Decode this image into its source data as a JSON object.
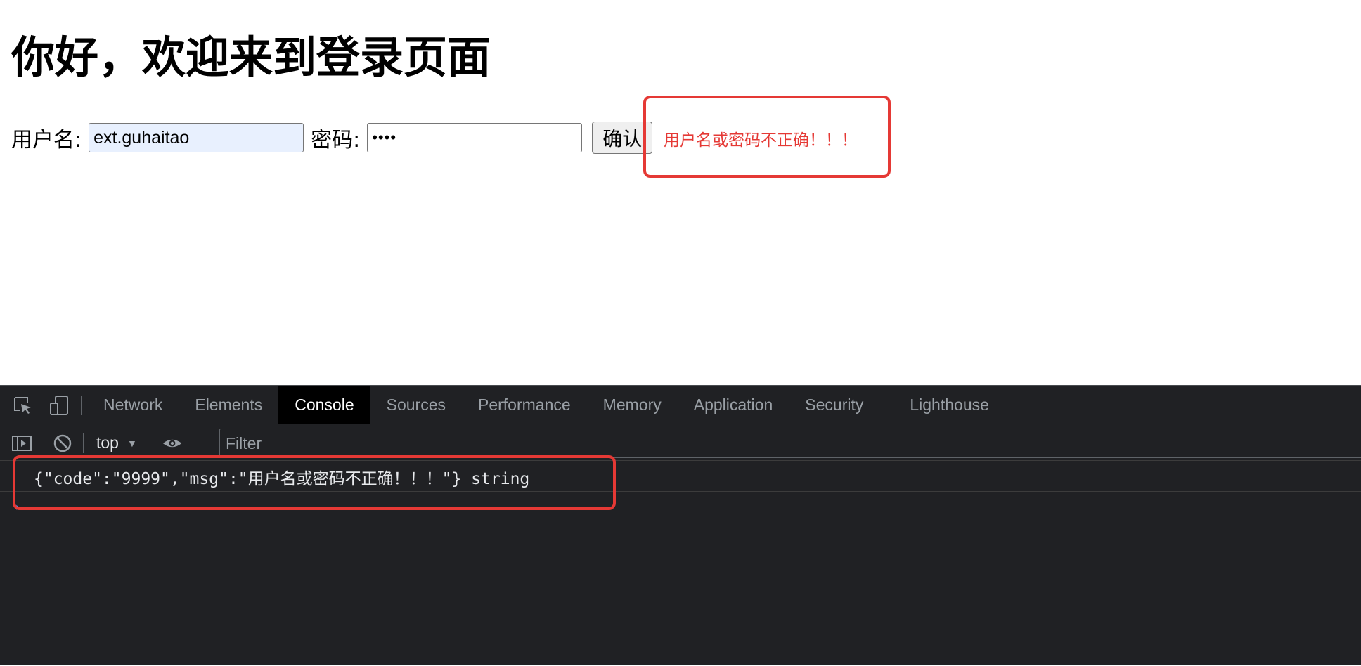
{
  "page": {
    "title": "你好，欢迎来到登录页面",
    "form": {
      "username_label": "用户名:",
      "username_value": "ext.guhaitao",
      "password_label": "密码:",
      "password_masked": "••••",
      "confirm_label": "确认"
    },
    "error_message": "用户名或密码不正确！！！"
  },
  "devtools": {
    "tabs": [
      {
        "label": "Network"
      },
      {
        "label": "Elements"
      },
      {
        "label": "Console",
        "active": true
      },
      {
        "label": "Sources"
      },
      {
        "label": "Performance"
      },
      {
        "label": "Memory"
      },
      {
        "label": "Application"
      },
      {
        "label": "Security"
      },
      {
        "label": "Lighthouse"
      }
    ],
    "toolbar": {
      "context": "top",
      "filter_placeholder": "Filter"
    },
    "console": {
      "log_line": "{\"code\":\"9999\",\"msg\":\"用户名或密码不正确！！！\"} string",
      "prompt": "›"
    },
    "icons": [
      "inspect-element-icon",
      "device-toolbar-icon",
      "sidebar-toggle-icon",
      "clear-console-icon",
      "dropdown-arrow-icon",
      "live-expression-eye-icon"
    ]
  },
  "colors": {
    "error_red": "#e53935",
    "devtools_bg": "#202124",
    "active_tab_bg": "#000000",
    "autofill_bg": "#e8f0fe"
  }
}
